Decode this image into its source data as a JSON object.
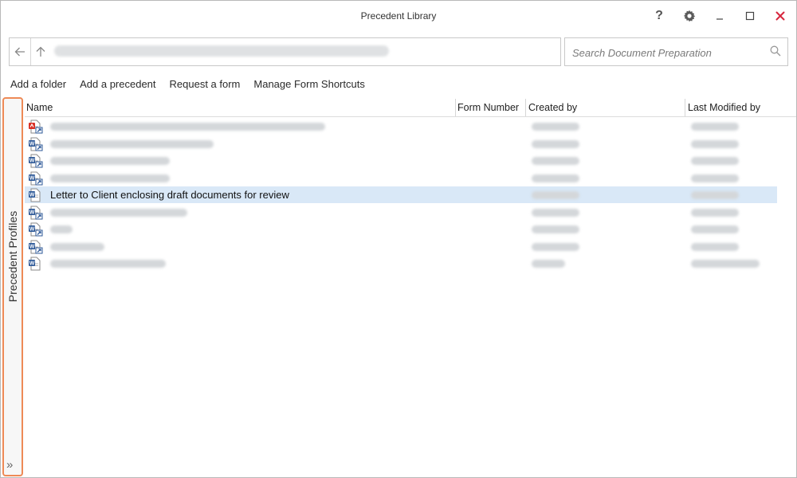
{
  "window": {
    "title": "Precedent Library"
  },
  "titlebar": {
    "help_label": "?",
    "minimize_label": "_"
  },
  "search": {
    "placeholder": "Search Document Preparation"
  },
  "toolbar": {
    "add_folder": "Add a folder",
    "add_precedent": "Add a precedent",
    "request_form": "Request a form",
    "manage_shortcuts": "Manage Form Shortcuts"
  },
  "side_panel": {
    "label": "Precedent Profiles",
    "expand_glyph": "»"
  },
  "table": {
    "columns": [
      "Name",
      "Form Number",
      "Created by",
      "Last Modified by"
    ],
    "rows": [
      {
        "icon": "pdf-shortcut-icon",
        "name": "",
        "created_by": "",
        "modified_by": "",
        "selected": false
      },
      {
        "icon": "word-shortcut-icon",
        "name": "",
        "created_by": "",
        "modified_by": "",
        "selected": false
      },
      {
        "icon": "word-shortcut-icon",
        "name": "",
        "created_by": "",
        "modified_by": "",
        "selected": false
      },
      {
        "icon": "word-shortcut-icon",
        "name": "",
        "created_by": "",
        "modified_by": "",
        "selected": false
      },
      {
        "icon": "word-doc-icon",
        "name": "Letter to Client enclosing draft documents for review",
        "created_by": "",
        "modified_by": "",
        "selected": true
      },
      {
        "icon": "word-shortcut-icon",
        "name": "",
        "created_by": "",
        "modified_by": "",
        "selected": false
      },
      {
        "icon": "word-shortcut-icon",
        "name": "",
        "created_by": "",
        "modified_by": "",
        "selected": false
      },
      {
        "icon": "word-shortcut-icon",
        "name": "",
        "created_by": "",
        "modified_by": "",
        "selected": false
      },
      {
        "icon": "word-doc-icon",
        "name": "",
        "created_by": "",
        "modified_by": "",
        "selected": false
      }
    ]
  },
  "colors": {
    "selection": "#d9e8f7",
    "panel_border": "#ee8a56",
    "close": "#d7263d",
    "word": "#2b5797",
    "pdf": "#d93025"
  }
}
